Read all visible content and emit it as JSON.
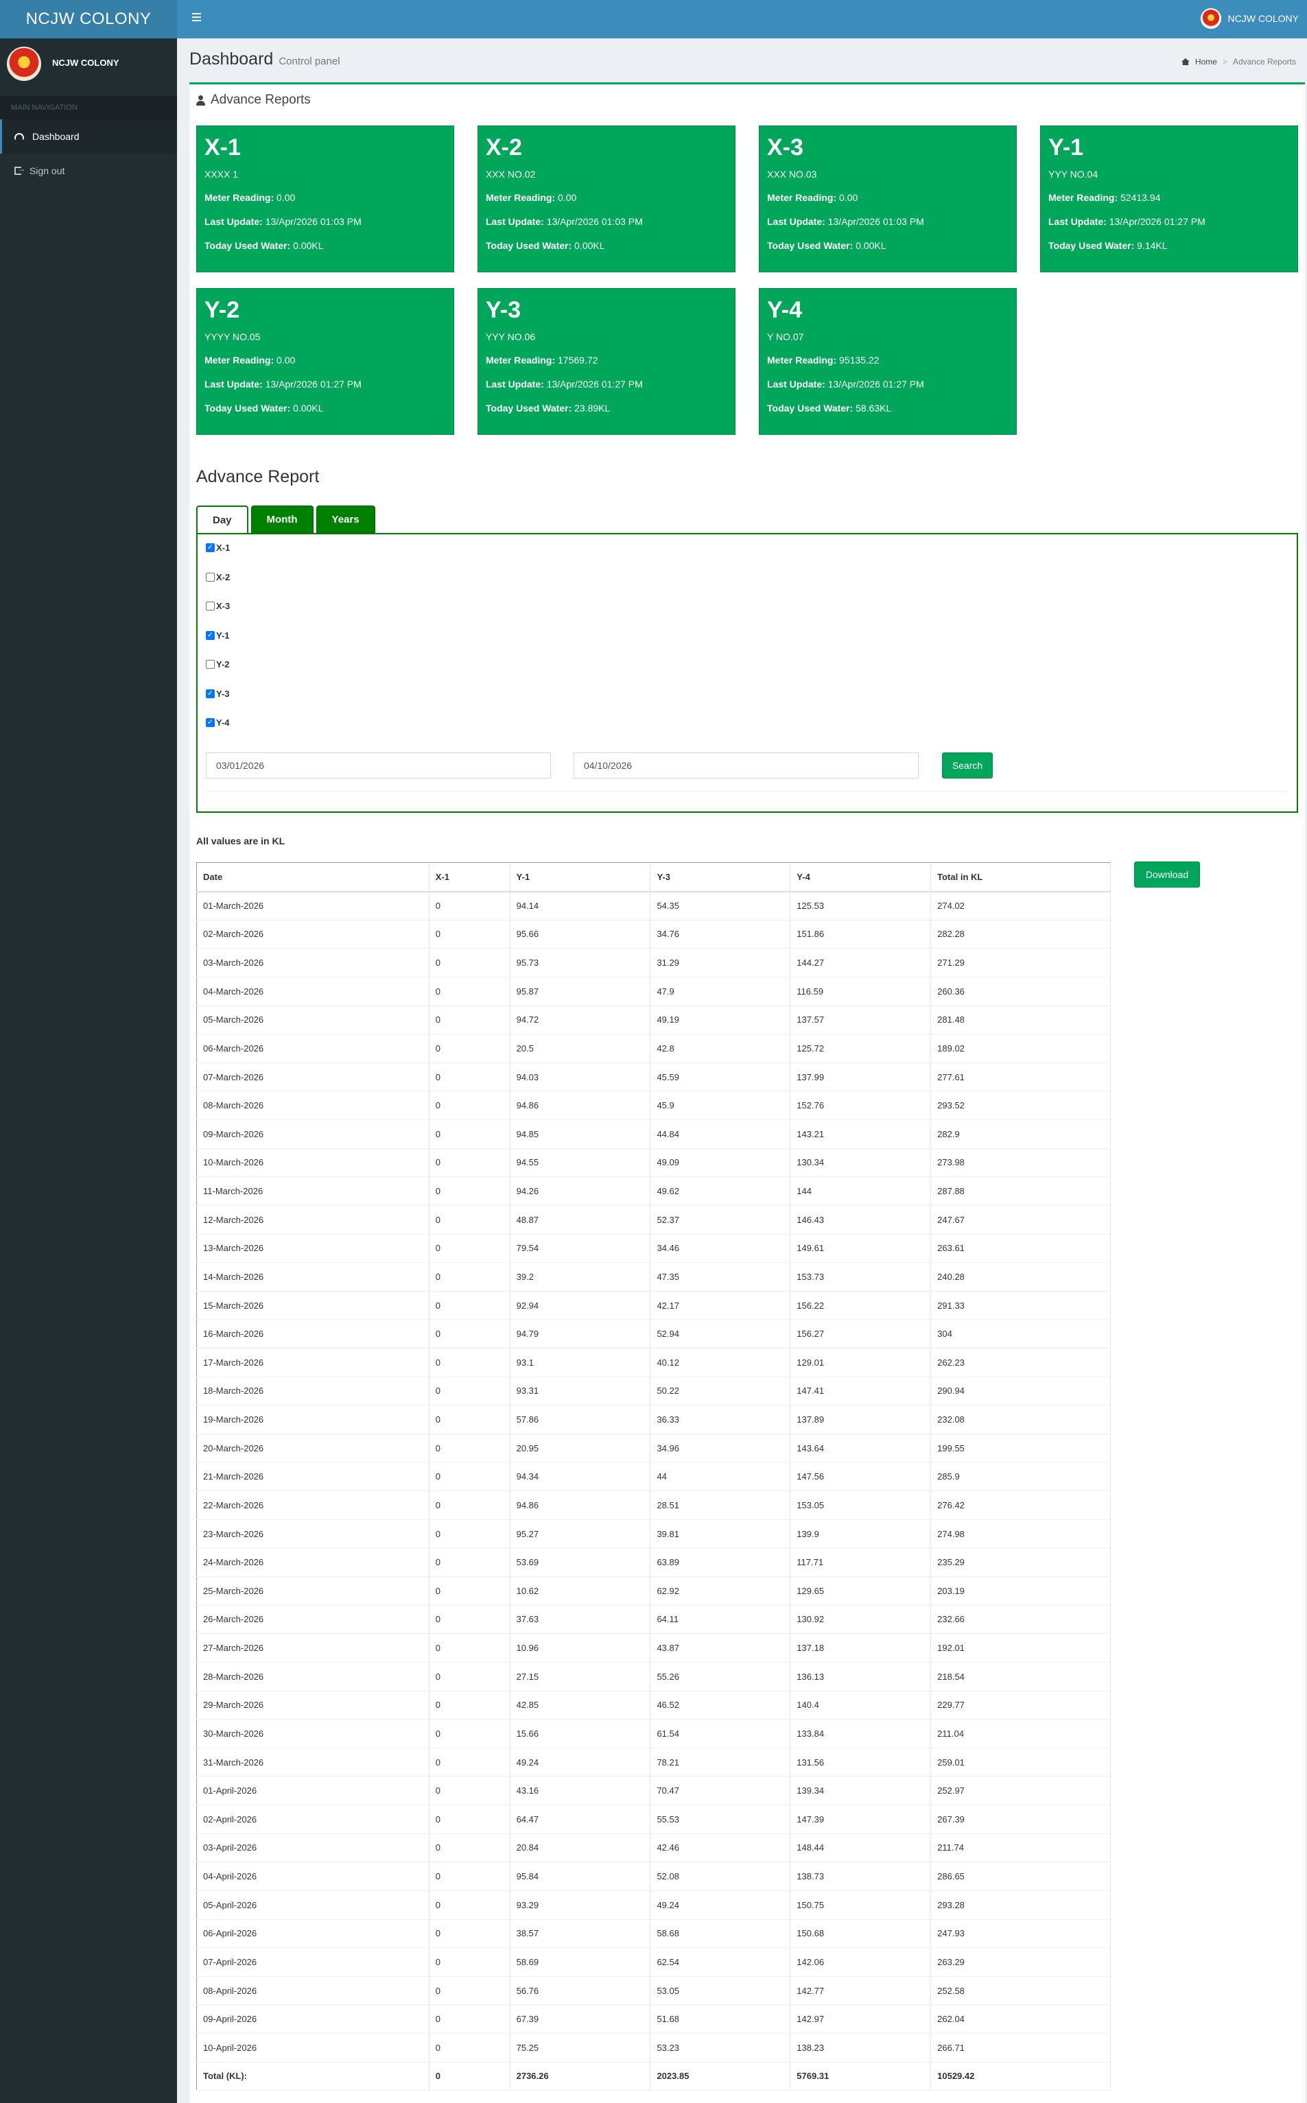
{
  "app": {
    "brand": "NCJW COLONY",
    "user_name": "NCJW COLONY"
  },
  "sidebar": {
    "header": "MAIN NAVIGATION",
    "items": [
      {
        "label": "Dashboard",
        "icon": "dashboard-icon",
        "active": true
      },
      {
        "label": "Sign out",
        "icon": "sign-out-icon",
        "active": false
      }
    ]
  },
  "page": {
    "title": "Dashboard",
    "subtitle": "Control panel"
  },
  "breadcrumb": {
    "home": "Home",
    "current": "Advance Reports"
  },
  "box_title": "Advance Reports",
  "meters": [
    {
      "title": "X-1",
      "code": "XXXX 1",
      "reading_label": "Meter Reading:",
      "reading": "0.00",
      "update_label": "Last Update:",
      "update": "13/Apr/2026 01:03 PM",
      "today_label": "Today Used Water:",
      "today": "0.00KL"
    },
    {
      "title": "X-2",
      "code": "XXX NO.02",
      "reading_label": "Meter Reading:",
      "reading": "0.00",
      "update_label": "Last Update:",
      "update": "13/Apr/2026 01:03 PM",
      "today_label": "Today Used Water:",
      "today": "0.00KL"
    },
    {
      "title": "X-3",
      "code": "XXX NO.03",
      "reading_label": "Meter Reading:",
      "reading": "0.00",
      "update_label": "Last Update:",
      "update": "13/Apr/2026 01:03 PM",
      "today_label": "Today Used Water:",
      "today": "0.00KL"
    },
    {
      "title": "Y-1",
      "code": "YYY NO.04",
      "reading_label": "Meter Reading:",
      "reading": "52413.94",
      "update_label": "Last Update:",
      "update": "13/Apr/2026 01:27 PM",
      "today_label": "Today Used Water:",
      "today": "9.14KL"
    },
    {
      "title": "Y-2",
      "code": "YYYY NO.05",
      "reading_label": "Meter Reading:",
      "reading": "0.00",
      "update_label": "Last Update:",
      "update": "13/Apr/2026 01:27 PM",
      "today_label": "Today Used Water:",
      "today": "0.00KL"
    },
    {
      "title": "Y-3",
      "code": "YYY NO.06",
      "reading_label": "Meter Reading:",
      "reading": "17569.72",
      "update_label": "Last Update:",
      "update": "13/Apr/2026 01:27 PM",
      "today_label": "Today Used Water:",
      "today": "23.89KL"
    },
    {
      "title": "Y-4",
      "code": "Y NO.07",
      "reading_label": "Meter Reading:",
      "reading": "95135.22",
      "update_label": "Last Update:",
      "update": "13/Apr/2026 01:27 PM",
      "today_label": "Today Used Water:",
      "today": "58.63KL"
    }
  ],
  "report": {
    "title": "Advance Report",
    "tabs": [
      {
        "label": "Day",
        "active": true
      },
      {
        "label": "Month",
        "active": false
      },
      {
        "label": "Years",
        "active": false
      }
    ],
    "checkboxes": [
      {
        "label": "X-1",
        "checked": true
      },
      {
        "label": "X-2",
        "checked": false
      },
      {
        "label": "X-3",
        "checked": false
      },
      {
        "label": "Y-1",
        "checked": true
      },
      {
        "label": "Y-2",
        "checked": false
      },
      {
        "label": "Y-3",
        "checked": true
      },
      {
        "label": "Y-4",
        "checked": true
      }
    ],
    "from_date": "03/01/2026",
    "to_date": "04/10/2026",
    "search_label": "Search",
    "units_note": "All values are in KL",
    "download_label": "Download"
  },
  "table": {
    "headers": [
      "Date",
      "X-1",
      "Y-1",
      "Y-3",
      "Y-4",
      "Total in KL"
    ],
    "rows": [
      [
        "01-March-2026",
        "0",
        "94.14",
        "54.35",
        "125.53",
        "274.02"
      ],
      [
        "02-March-2026",
        "0",
        "95.66",
        "34.76",
        "151.86",
        "282.28"
      ],
      [
        "03-March-2026",
        "0",
        "95.73",
        "31.29",
        "144.27",
        "271.29"
      ],
      [
        "04-March-2026",
        "0",
        "95.87",
        "47.9",
        "116.59",
        "260.36"
      ],
      [
        "05-March-2026",
        "0",
        "94.72",
        "49.19",
        "137.57",
        "281.48"
      ],
      [
        "06-March-2026",
        "0",
        "20.5",
        "42.8",
        "125.72",
        "189.02"
      ],
      [
        "07-March-2026",
        "0",
        "94.03",
        "45.59",
        "137.99",
        "277.61"
      ],
      [
        "08-March-2026",
        "0",
        "94.86",
        "45.9",
        "152.76",
        "293.52"
      ],
      [
        "09-March-2026",
        "0",
        "94.85",
        "44.84",
        "143.21",
        "282.9"
      ],
      [
        "10-March-2026",
        "0",
        "94.55",
        "49.09",
        "130.34",
        "273.98"
      ],
      [
        "11-March-2026",
        "0",
        "94.26",
        "49.62",
        "144",
        "287.88"
      ],
      [
        "12-March-2026",
        "0",
        "48.87",
        "52.37",
        "146.43",
        "247.67"
      ],
      [
        "13-March-2026",
        "0",
        "79.54",
        "34.46",
        "149.61",
        "263.61"
      ],
      [
        "14-March-2026",
        "0",
        "39.2",
        "47.35",
        "153.73",
        "240.28"
      ],
      [
        "15-March-2026",
        "0",
        "92.94",
        "42.17",
        "156.22",
        "291.33"
      ],
      [
        "16-March-2026",
        "0",
        "94.79",
        "52.94",
        "156.27",
        "304"
      ],
      [
        "17-March-2026",
        "0",
        "93.1",
        "40.12",
        "129.01",
        "262.23"
      ],
      [
        "18-March-2026",
        "0",
        "93.31",
        "50.22",
        "147.41",
        "290.94"
      ],
      [
        "19-March-2026",
        "0",
        "57.86",
        "36.33",
        "137.89",
        "232.08"
      ],
      [
        "20-March-2026",
        "0",
        "20.95",
        "34.96",
        "143.64",
        "199.55"
      ],
      [
        "21-March-2026",
        "0",
        "94.34",
        "44",
        "147.56",
        "285.9"
      ],
      [
        "22-March-2026",
        "0",
        "94.86",
        "28.51",
        "153.05",
        "276.42"
      ],
      [
        "23-March-2026",
        "0",
        "95.27",
        "39.81",
        "139.9",
        "274.98"
      ],
      [
        "24-March-2026",
        "0",
        "53.69",
        "63.89",
        "117.71",
        "235.29"
      ],
      [
        "25-March-2026",
        "0",
        "10.62",
        "62.92",
        "129.65",
        "203.19"
      ],
      [
        "26-March-2026",
        "0",
        "37.63",
        "64.11",
        "130.92",
        "232.66"
      ],
      [
        "27-March-2026",
        "0",
        "10.96",
        "43.87",
        "137.18",
        "192.01"
      ],
      [
        "28-March-2026",
        "0",
        "27.15",
        "55.26",
        "136.13",
        "218.54"
      ],
      [
        "29-March-2026",
        "0",
        "42.85",
        "46.52",
        "140.4",
        "229.77"
      ],
      [
        "30-March-2026",
        "0",
        "15.66",
        "61.54",
        "133.84",
        "211.04"
      ],
      [
        "31-March-2026",
        "0",
        "49.24",
        "78.21",
        "131.56",
        "259.01"
      ],
      [
        "01-April-2026",
        "0",
        "43.16",
        "70.47",
        "139.34",
        "252.97"
      ],
      [
        "02-April-2026",
        "0",
        "64.47",
        "55.53",
        "147.39",
        "267.39"
      ],
      [
        "03-April-2026",
        "0",
        "20.84",
        "42.46",
        "148.44",
        "211.74"
      ],
      [
        "04-April-2026",
        "0",
        "95.84",
        "52.08",
        "138.73",
        "286.65"
      ],
      [
        "05-April-2026",
        "0",
        "93.29",
        "49.24",
        "150.75",
        "293.28"
      ],
      [
        "06-April-2026",
        "0",
        "38.57",
        "58.68",
        "150.68",
        "247.93"
      ],
      [
        "07-April-2026",
        "0",
        "58.69",
        "62.54",
        "142.06",
        "263.29"
      ],
      [
        "08-April-2026",
        "0",
        "56.76",
        "53.05",
        "142.77",
        "252.58"
      ],
      [
        "09-April-2026",
        "0",
        "67.39",
        "51.68",
        "142.97",
        "262.04"
      ],
      [
        "10-April-2026",
        "0",
        "75.25",
        "53.23",
        "138.23",
        "266.71"
      ]
    ],
    "total_row": [
      "Total (KL):",
      "0",
      "2736.26",
      "2023.85",
      "5769.31",
      "10529.42"
    ]
  },
  "colors": {
    "header": "#3c8dbc",
    "logo": "#367fa9",
    "sidebar": "#222d32",
    "card": "#00a65a",
    "tab": "#008000"
  }
}
